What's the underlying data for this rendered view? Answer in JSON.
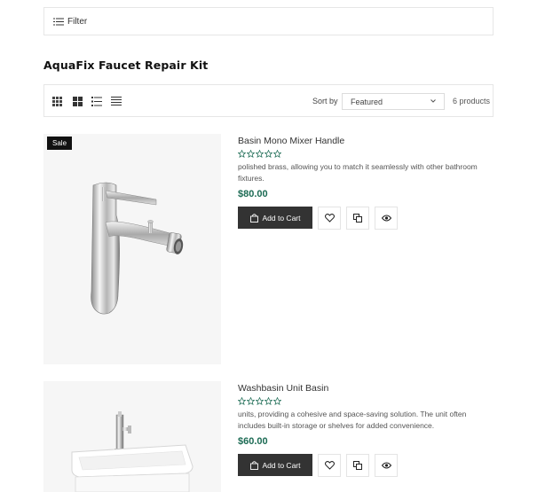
{
  "filter": {
    "label": "Filter",
    "icon": "filter-lines-icon"
  },
  "page": {
    "title": "AquaFix Faucet Repair Kit"
  },
  "toolbar": {
    "views": [
      "grid-3-icon",
      "grid-2-icon",
      "list-numbered-icon",
      "list-icon"
    ],
    "sort_label": "Sort by",
    "sort_value": "Featured",
    "count": "6 products"
  },
  "products": [
    {
      "badge": "Sale",
      "name": "Basin Mono Mixer Handle",
      "rating_stars": 5,
      "rating_filled": 0,
      "description": "polished brass, allowing you to match it seamlessly with other bathroom fixtures.",
      "price": "$80.00",
      "add_to_cart": "Add to Cart"
    },
    {
      "badge": "",
      "name": "Washbasin Unit Basin",
      "rating_stars": 5,
      "rating_filled": 0,
      "description": "units, providing a cohesive and space-saving solution. The unit often includes built-in storage or shelves for added convenience.",
      "price": "$60.00",
      "add_to_cart": "Add to Cart"
    }
  ],
  "colors": {
    "price": "#1c6b54",
    "star": "#1c6b54",
    "button": "#333333",
    "badge": "#111111"
  }
}
